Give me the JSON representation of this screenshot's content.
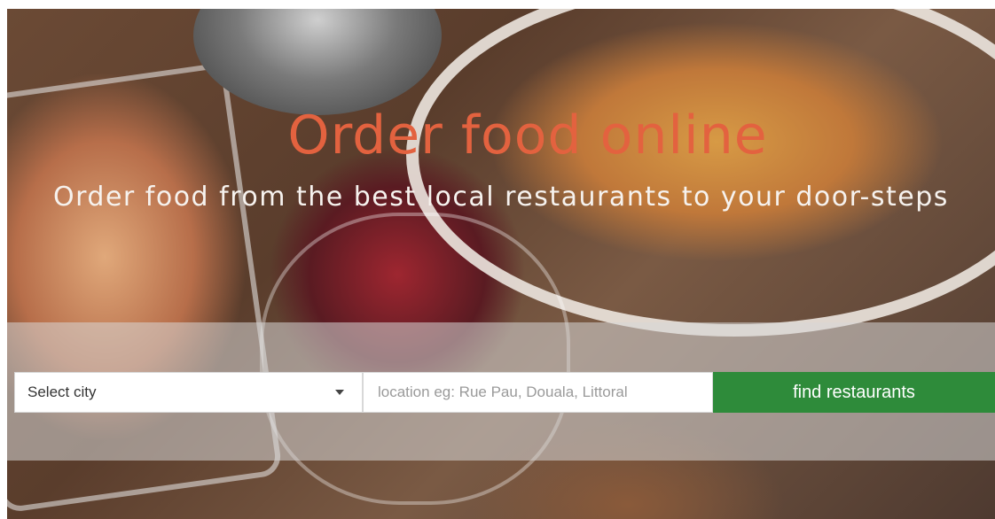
{
  "hero": {
    "title": "Order food online",
    "subtitle": "Order food from the best local restaurants to your door-steps"
  },
  "search": {
    "city_select": {
      "selected": "Select city"
    },
    "location_placeholder": "location eg: Rue Pau, Douala, Littoral",
    "submit_label": "find restaurants"
  },
  "colors": {
    "title": "#e3623f",
    "subtitle": "#f6f2ee",
    "button_bg": "#2e8b3a",
    "button_text": "#ffffff",
    "band": "rgba(215,215,215,0.55)"
  },
  "icons": {
    "select_caret": "chevron-down-icon"
  }
}
